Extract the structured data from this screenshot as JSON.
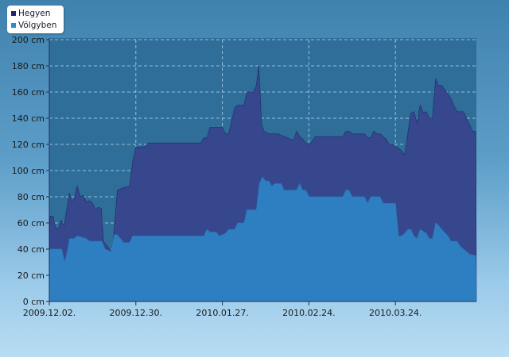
{
  "colors": {
    "hegyen": "#36478e",
    "volgyben": "#2e7fc1",
    "plot_bg": "#2f6e99",
    "gridline": "#a9cde4",
    "axis_text": "#1a1a1a"
  },
  "legend": {
    "items": [
      {
        "label": "Hegyen",
        "color": "#1e2470"
      },
      {
        "label": "Völgyben",
        "color": "#2c8ad2"
      }
    ]
  },
  "chart_data": {
    "type": "area",
    "title": "",
    "xlabel": "",
    "ylabel": "",
    "ylim": [
      0,
      200
    ],
    "yticks": [
      0,
      20,
      40,
      60,
      80,
      100,
      120,
      140,
      160,
      180,
      200
    ],
    "ytick_labels": [
      "0 cm",
      "20 cm",
      "40 cm",
      "60 cm",
      "80 cm",
      "100 cm",
      "120 cm",
      "140 cm",
      "160 cm",
      "180 cm",
      "200 cm"
    ],
    "xticks": [
      {
        "label": "2009.12.02.",
        "day": 0
      },
      {
        "label": "2009.12.30.",
        "day": 28
      },
      {
        "label": "2010.01.27.",
        "day": 56
      },
      {
        "label": "2010.02.24.",
        "day": 84
      },
      {
        "label": "2010.03.24.",
        "day": 112
      }
    ],
    "grid": true,
    "legend_position": "top-left",
    "series": [
      {
        "name": "Hegyen",
        "points": [
          [
            0,
            0
          ],
          [
            0.2,
            65
          ],
          [
            1.2,
            65
          ],
          [
            2,
            56
          ],
          [
            3,
            56
          ],
          [
            3.8,
            62
          ],
          [
            4.8,
            58
          ],
          [
            5.5,
            68
          ],
          [
            6.5,
            83
          ],
          [
            7.2,
            77
          ],
          [
            8,
            78
          ],
          [
            9,
            88
          ],
          [
            10,
            80
          ],
          [
            11,
            81
          ],
          [
            12,
            76
          ],
          [
            13,
            77
          ],
          [
            14,
            75
          ],
          [
            15,
            70
          ],
          [
            15.8,
            72
          ],
          [
            16.8,
            71
          ],
          [
            17.5,
            46
          ],
          [
            18.5,
            43
          ],
          [
            19.5,
            40
          ],
          [
            20.3,
            38
          ],
          [
            21,
            55
          ],
          [
            22,
            85
          ],
          [
            23,
            86
          ],
          [
            24,
            87
          ],
          [
            26,
            88
          ],
          [
            27,
            107
          ],
          [
            28,
            118
          ],
          [
            31,
            118
          ],
          [
            32,
            121
          ],
          [
            49,
            121
          ],
          [
            50,
            125
          ],
          [
            51,
            125
          ],
          [
            52,
            133
          ],
          [
            56,
            133
          ],
          [
            57,
            128
          ],
          [
            58,
            128
          ],
          [
            59,
            138
          ],
          [
            60,
            148
          ],
          [
            61,
            150
          ],
          [
            63,
            150
          ],
          [
            64,
            160
          ],
          [
            66,
            160
          ],
          [
            67,
            165
          ],
          [
            67.8,
            180
          ],
          [
            68.7,
            135
          ],
          [
            69.5,
            130
          ],
          [
            71,
            128
          ],
          [
            74,
            128
          ],
          [
            75,
            127
          ],
          [
            77,
            125
          ],
          [
            78,
            124
          ],
          [
            79,
            123
          ],
          [
            80,
            130
          ],
          [
            81,
            126
          ],
          [
            82,
            124
          ],
          [
            83,
            121
          ],
          [
            84,
            120
          ],
          [
            85,
            122
          ],
          [
            86,
            126
          ],
          [
            95,
            126
          ],
          [
            96,
            130
          ],
          [
            97,
            130
          ],
          [
            98,
            128
          ],
          [
            102,
            128
          ],
          [
            103,
            125
          ],
          [
            104,
            125
          ],
          [
            105,
            130
          ],
          [
            106,
            128
          ],
          [
            107,
            128
          ],
          [
            109,
            124
          ],
          [
            110,
            120
          ],
          [
            111,
            120
          ],
          [
            113,
            117
          ],
          [
            114,
            115
          ],
          [
            115,
            112
          ],
          [
            116,
            128
          ],
          [
            117,
            144
          ],
          [
            118,
            145
          ],
          [
            119,
            136
          ],
          [
            120,
            150
          ],
          [
            121,
            144
          ],
          [
            122,
            145
          ],
          [
            123,
            140
          ],
          [
            124,
            140
          ],
          [
            125,
            170
          ],
          [
            126,
            165
          ],
          [
            127,
            165
          ],
          [
            130,
            155
          ],
          [
            131,
            149
          ],
          [
            132,
            145
          ],
          [
            134,
            145
          ],
          [
            135,
            140
          ],
          [
            136,
            135
          ],
          [
            137,
            130
          ],
          [
            138,
            130
          ],
          [
            138.2,
            0
          ]
        ]
      },
      {
        "name": "Völgyben",
        "points": [
          [
            0,
            0
          ],
          [
            0.2,
            40
          ],
          [
            1,
            40
          ],
          [
            4,
            40
          ],
          [
            5,
            30
          ],
          [
            6,
            40
          ],
          [
            6.5,
            48
          ],
          [
            8,
            48
          ],
          [
            9,
            50
          ],
          [
            12,
            48
          ],
          [
            13,
            46
          ],
          [
            17,
            46
          ],
          [
            18,
            40
          ],
          [
            20,
            38
          ],
          [
            21,
            51
          ],
          [
            22,
            51
          ],
          [
            23,
            48
          ],
          [
            24,
            45
          ],
          [
            26,
            45
          ],
          [
            27,
            50
          ],
          [
            50,
            50
          ],
          [
            51,
            55
          ],
          [
            52,
            53
          ],
          [
            54,
            53
          ],
          [
            55,
            50
          ],
          [
            57,
            52
          ],
          [
            58,
            55
          ],
          [
            60,
            55
          ],
          [
            61,
            60
          ],
          [
            63,
            60
          ],
          [
            64,
            70
          ],
          [
            67,
            70
          ],
          [
            68,
            90
          ],
          [
            69,
            95
          ],
          [
            70,
            92
          ],
          [
            71,
            92
          ],
          [
            72,
            88
          ],
          [
            73,
            90
          ],
          [
            75,
            90
          ],
          [
            76,
            85
          ],
          [
            80,
            85
          ],
          [
            81,
            90
          ],
          [
            82,
            85
          ],
          [
            83,
            85
          ],
          [
            84,
            80
          ],
          [
            95,
            80
          ],
          [
            96,
            85
          ],
          [
            97,
            85
          ],
          [
            98,
            80
          ],
          [
            102,
            80
          ],
          [
            103,
            75
          ],
          [
            104,
            80
          ],
          [
            107,
            80
          ],
          [
            108,
            75
          ],
          [
            112,
            75
          ],
          [
            113,
            50
          ],
          [
            114,
            50
          ],
          [
            115,
            52
          ],
          [
            116,
            55
          ],
          [
            117,
            55
          ],
          [
            118,
            50
          ],
          [
            119,
            48
          ],
          [
            120,
            55
          ],
          [
            122,
            52
          ],
          [
            123,
            48
          ],
          [
            124,
            48
          ],
          [
            125,
            60
          ],
          [
            126,
            58
          ],
          [
            127,
            55
          ],
          [
            129,
            50
          ],
          [
            130,
            46
          ],
          [
            132,
            46
          ],
          [
            133,
            42
          ],
          [
            134,
            40
          ],
          [
            135,
            38
          ],
          [
            136,
            36
          ],
          [
            138,
            35
          ],
          [
            138.2,
            0
          ]
        ]
      }
    ]
  }
}
